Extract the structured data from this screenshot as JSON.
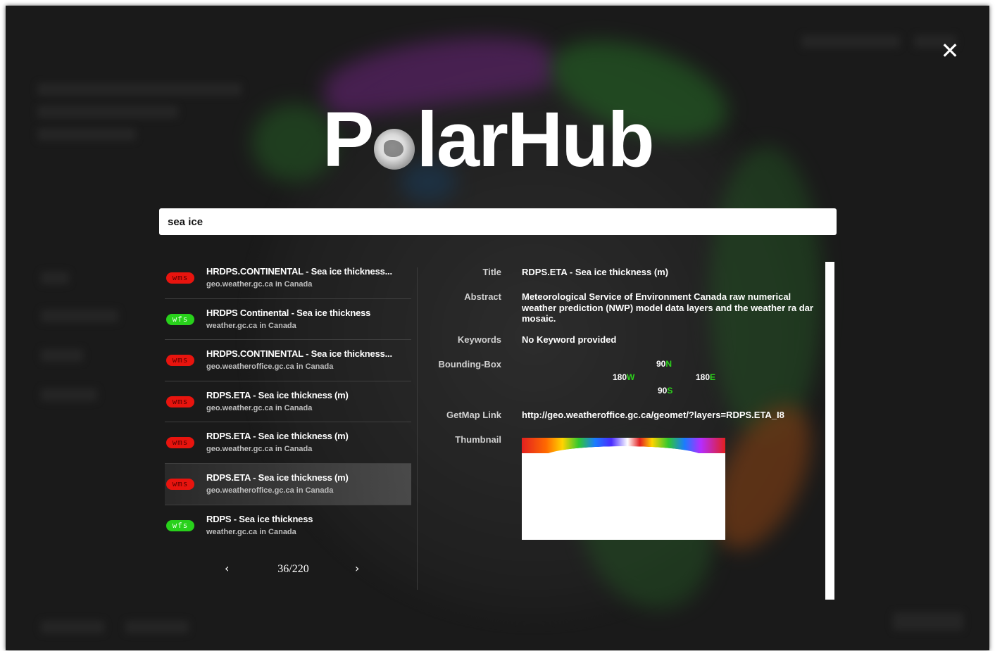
{
  "app": {
    "logo_before": "P",
    "logo_after": "larHub"
  },
  "search": {
    "value": "sea ice"
  },
  "results": [
    {
      "badge": "wms",
      "badge_type": "wms",
      "title": "HRDPS.CONTINENTAL - Sea ice thickness...",
      "source": "geo.weather.gc.ca in Canada"
    },
    {
      "badge": "wfs",
      "badge_type": "wfs",
      "title": "HRDPS Continental - Sea ice thickness",
      "source": "weather.gc.ca in Canada"
    },
    {
      "badge": "wms",
      "badge_type": "wms",
      "title": "HRDPS.CONTINENTAL - Sea ice thickness...",
      "source": "geo.weatheroffice.gc.ca in Canada"
    },
    {
      "badge": "wms",
      "badge_type": "wms",
      "title": "RDPS.ETA - Sea ice thickness (m)",
      "source": "geo.weather.gc.ca in Canada"
    },
    {
      "badge": "wms",
      "badge_type": "wms",
      "title": "RDPS.ETA - Sea ice thickness (m)",
      "source": "geo.weather.gc.ca in Canada"
    },
    {
      "badge": "wms",
      "badge_type": "wms",
      "title": "RDPS.ETA - Sea ice thickness (m)",
      "source": "geo.weatheroffice.gc.ca in Canada"
    },
    {
      "badge": "wfs",
      "badge_type": "wfs",
      "title": "RDPS - Sea ice thickness",
      "source": "weather.gc.ca in Canada"
    }
  ],
  "pagination": {
    "prev": "‹",
    "next": "›",
    "info": "36/220"
  },
  "detail": {
    "title_label": "Title",
    "title_value": "RDPS.ETA - Sea ice thickness (m)",
    "abstract_label": "Abstract",
    "abstract_value": "Meteorological Service of Environment Canada raw numerical weather prediction (NWP) model data layers and the weather ra dar mosaic.",
    "keywords_label": "Keywords",
    "keywords_value": "No Keyword provided",
    "bbox_label": "Bounding-Box",
    "bbox": {
      "north_val": "90",
      "north_dir": "N",
      "west_val": "180",
      "west_dir": "W",
      "east_val": "180",
      "east_dir": "E",
      "south_val": "90",
      "south_dir": "S"
    },
    "getmap_label": "GetMap Link",
    "getmap_value": "http://geo.weatheroffice.gc.ca/geomet/?layers=RDPS.ETA_I8",
    "thumbnail_label": "Thumbnail"
  },
  "colors": {
    "wms_badge": "#e8140e",
    "wfs_badge": "#28d11b",
    "bbox_direction": "#2cd21c"
  },
  "icons": {
    "close": "close-icon",
    "prev": "chevron-left-icon",
    "next": "chevron-right-icon"
  }
}
